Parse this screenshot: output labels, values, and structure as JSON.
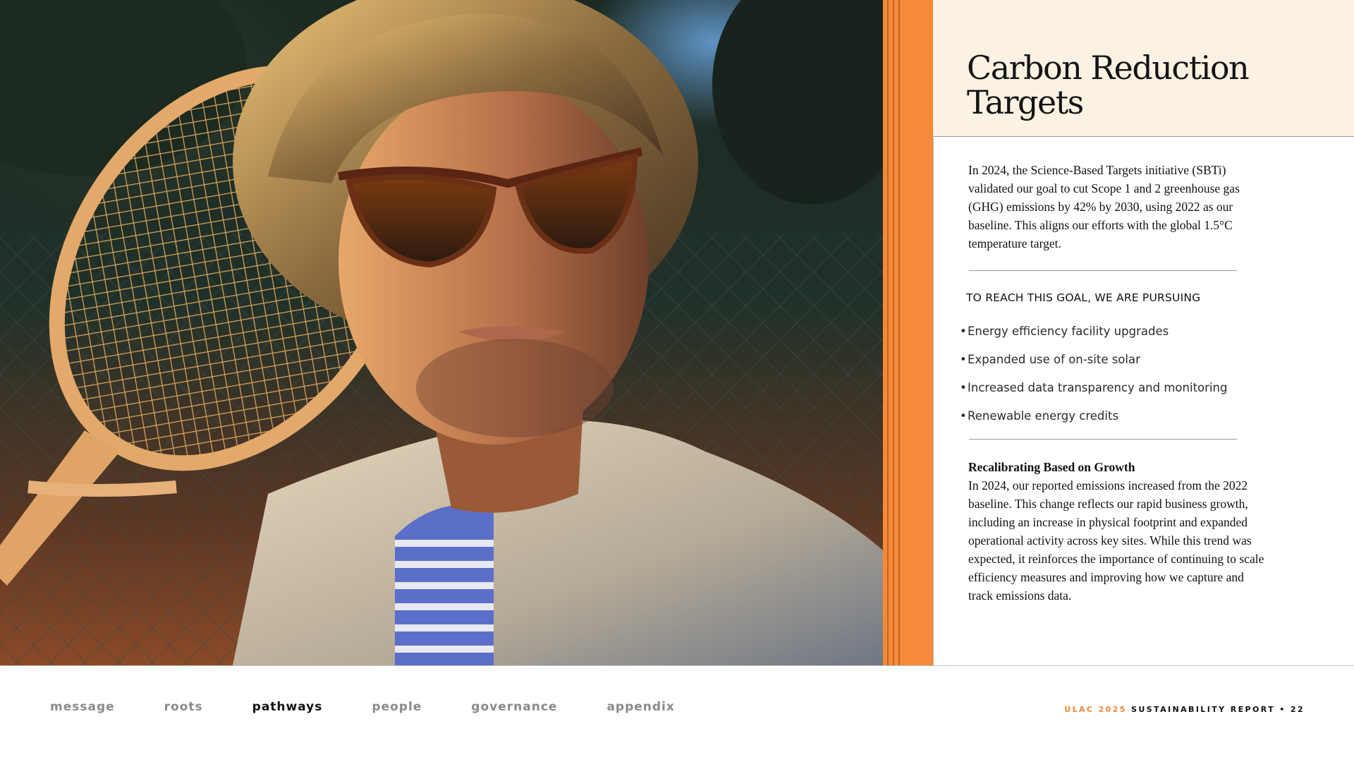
{
  "section": {
    "title": "Carbon Reduction Targets",
    "intro": "In 2024, the Science-Based Targets initiative (SBTi) validated our goal to cut Scope 1 and 2 greenhouse gas (GHG) emissions by 42% by 2030, using 2022 as our baseline. This aligns our efforts with the global 1.5°C temperature target.",
    "pursuing_heading": "TO REACH THIS GOAL, WE ARE PURSUING",
    "pursuing_items": [
      "Energy efficiency facility upgrades",
      "Expanded use of on-site solar",
      "Increased data transparency and monitoring",
      "Renewable energy credits"
    ],
    "growth_heading": "Recalibrating Based on Growth",
    "growth_text": "In 2024, our reported emissions increased from the 2022 baseline. This change reflects our rapid business growth, including an increase in physical footprint and expanded operational activity across key sites. While this trend was expected, it reinforces the importance of continuing to scale efficiency measures and improving how we capture and track emissions data."
  },
  "nav": {
    "items": [
      "message",
      "roots",
      "pathways",
      "people",
      "governance",
      "appendix"
    ],
    "active": "pathways"
  },
  "footer": {
    "brand": "ULAC 2025",
    "report": "SUSTAINABILITY REPORT",
    "separator": "•",
    "page": "22"
  },
  "colors": {
    "accent_orange": "#f58a3a",
    "header_cream": "#fcf2e3",
    "nav_inactive": "#8a8a8a",
    "nav_active": "#111111"
  }
}
